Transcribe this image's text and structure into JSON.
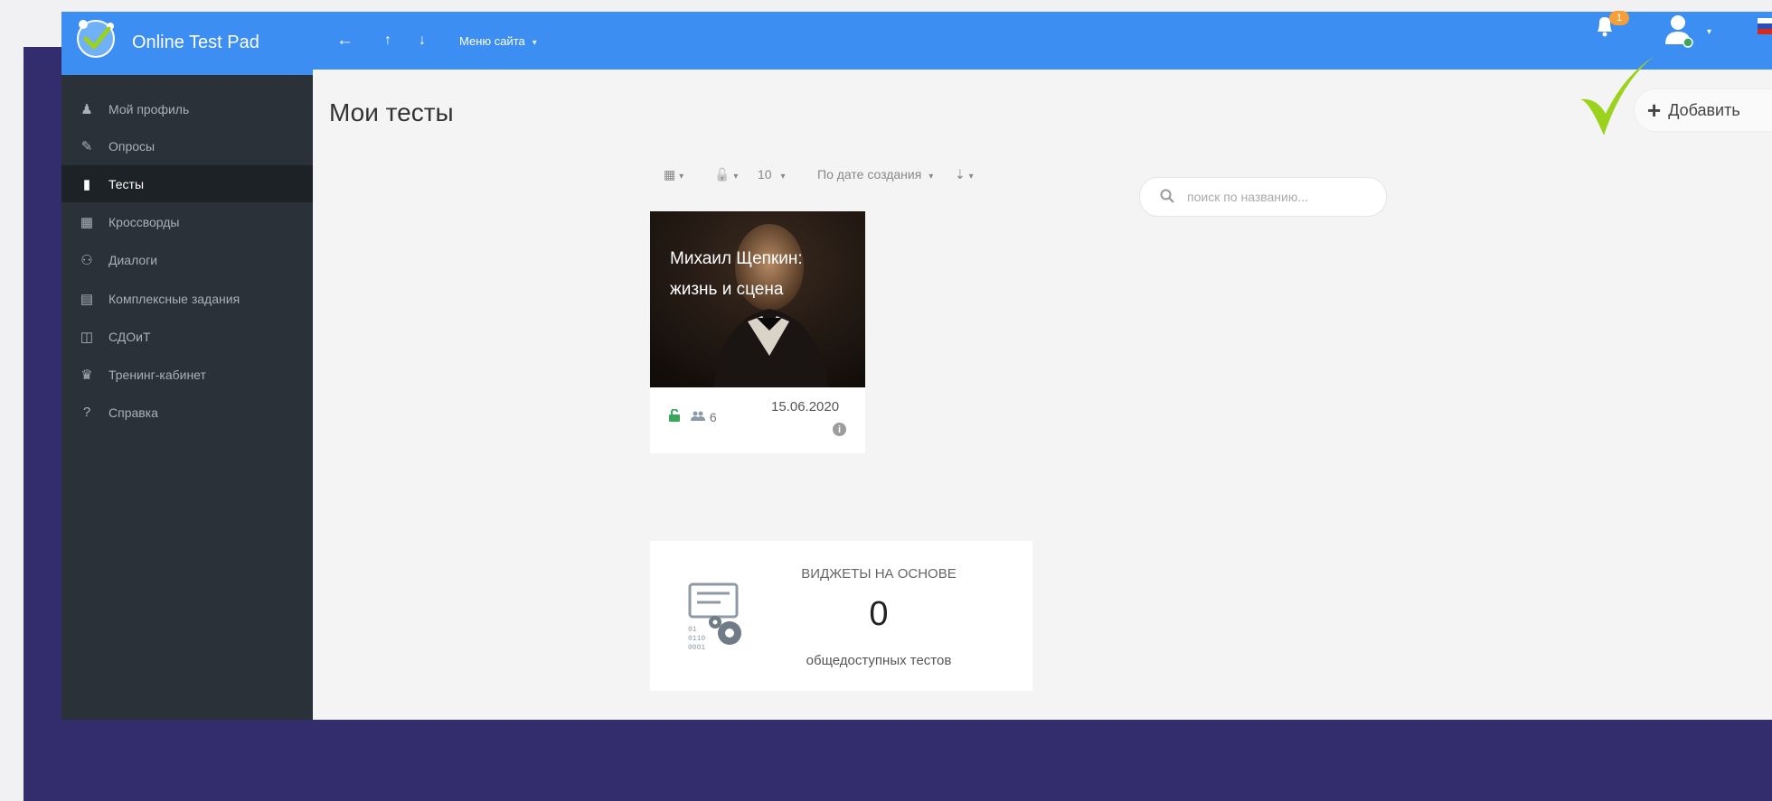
{
  "header": {
    "brand": "Online Test Pad",
    "nav_back_icon": "←",
    "nav_up_icon": "↑",
    "nav_down_icon": "↓",
    "menu_label": "Меню сайта",
    "menu_caret": "▾",
    "notifications_badge": "1",
    "user_caret": "▾"
  },
  "sidebar": {
    "items": [
      {
        "label": "Мой профиль",
        "icon": "user-icon",
        "glyph": "♟"
      },
      {
        "label": "Опросы",
        "icon": "survey-icon",
        "glyph": "✎"
      },
      {
        "label": "Тесты",
        "icon": "tests-icon",
        "glyph": "▮"
      },
      {
        "label": "Кроссворды",
        "icon": "grid-icon",
        "glyph": "▦"
      },
      {
        "label": "Диалоги",
        "icon": "dialogs-icon",
        "glyph": "⚇"
      },
      {
        "label": "Комплексные задания",
        "icon": "tasks-icon",
        "glyph": "▤"
      },
      {
        "label": "СДОиТ",
        "icon": "sdoit-icon",
        "glyph": "◫"
      },
      {
        "label": "Тренинг-кабинет",
        "icon": "graduation-icon",
        "glyph": "♛"
      },
      {
        "label": "Справка",
        "icon": "help-icon",
        "glyph": "?"
      }
    ],
    "active_index": 2
  },
  "main": {
    "title": "Мои тесты",
    "add_label": "Добавить",
    "add_plus": "+",
    "toolbar": {
      "view_icon": "▦",
      "lock_icon": "🔓",
      "count": "10",
      "sort_label": "По дате создания",
      "sort_icon": "⇣",
      "caret": "▾"
    },
    "search_placeholder": "поиск по названию...",
    "search_icon": "⌕",
    "test_card": {
      "title": "Михаил Щепкин: жизнь и сцена",
      "users": "6",
      "date": "15.06.2020",
      "info": "i"
    },
    "widget": {
      "heading": "ВИДЖЕТЫ НА ОСНОВЕ",
      "count": "0",
      "subtitle": "общедоступных тестов"
    }
  },
  "colors": {
    "topbar": "#3d8ef2",
    "sidebar": "#2b3138",
    "background_frame": "#332c6d",
    "check_mark": "#9bd21c",
    "lock_green": "#3aa85a",
    "badge": "#f59f3a"
  }
}
